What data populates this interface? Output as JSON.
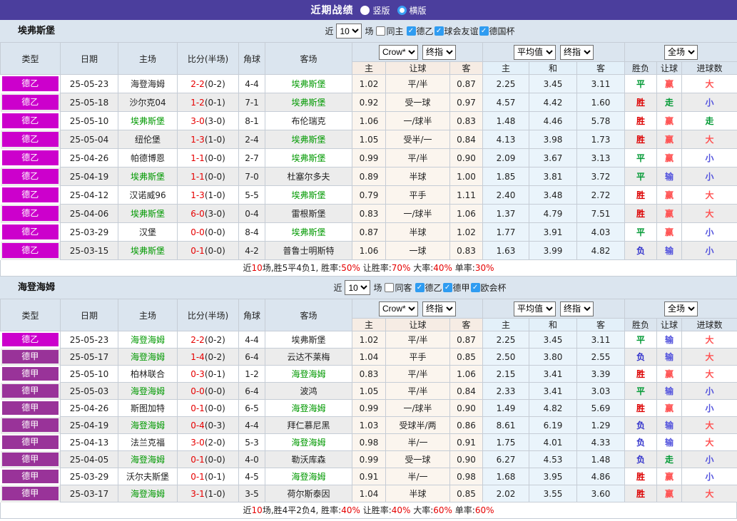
{
  "palette": {
    "titlebar_bg": "#4b3e9d",
    "band_bg": "#dbe5ef",
    "header_bg": "#dbe5ef",
    "row_alt_bg": "#ececec",
    "crow_columns_bg": "#fbf5ee",
    "avg_columns_bg": "#eaf4fb",
    "team_highlight": "#009900",
    "score_red": "#e60000",
    "win_red": "#dd0000",
    "draw_green": "#009933",
    "loss_blue": "#3333cc",
    "cover_red": "#ff5252",
    "fail_blue": "#5252dd",
    "checkbox_blue": "#2f9cf1",
    "type_colors": {
      "de2": "#cc00cc",
      "de1": "#993399"
    }
  },
  "titlebar": {
    "title": "近期战绩",
    "radio_vertical": "竖版",
    "radio_horizontal": "横版"
  },
  "table_header": {
    "cols": [
      "类型",
      "日期",
      "主场",
      "比分(半场)",
      "角球",
      "客场"
    ],
    "group1_selects": [
      "Crow*",
      "终指"
    ],
    "group2_selects": [
      "平均值",
      "终指"
    ],
    "group3_select": "全场",
    "sub1": [
      "主",
      "让球",
      "客"
    ],
    "sub2": [
      "主",
      "和",
      "客"
    ],
    "sub3": [
      "胜负",
      "让球",
      "进球数"
    ]
  },
  "sections": [
    {
      "team": "埃弗斯堡",
      "filter": {
        "prefix": "近",
        "count": "10",
        "suffix": "场",
        "uncheck_label": "同主",
        "checks": [
          "德乙",
          "球会友谊",
          "德国杯"
        ]
      },
      "rows": [
        {
          "lg": "de2",
          "type": "德乙",
          "date": "25-05-23",
          "home": "海登海姆",
          "hh": false,
          "ft": "2-2",
          "ht": "(0-2)",
          "corner": "4-4",
          "away": "埃弗斯堡",
          "ah": true,
          "h": "1.02",
          "hc": "平/半",
          "a": "0.87",
          "m1": "2.25",
          "m2": "3.45",
          "m3": "3.11",
          "res": [
            "平",
            "g"
          ],
          "asia": [
            "赢",
            "rl"
          ],
          "ou": [
            "大",
            "rl"
          ]
        },
        {
          "lg": "de2",
          "type": "德乙",
          "date": "25-05-18",
          "home": "沙尔克04",
          "hh": false,
          "ft": "1-2",
          "ht": "(0-1)",
          "corner": "7-1",
          "away": "埃弗斯堡",
          "ah": true,
          "h": "0.92",
          "hc": "受一球",
          "a": "0.97",
          "m1": "4.57",
          "m2": "4.42",
          "m3": "1.60",
          "res": [
            "胜",
            "r"
          ],
          "asia": [
            "走",
            "g"
          ],
          "ou": [
            "小",
            "bl"
          ]
        },
        {
          "lg": "de2",
          "type": "德乙",
          "date": "25-05-10",
          "home": "埃弗斯堡",
          "hh": true,
          "ft": "3-0",
          "ht": "(3-0)",
          "corner": "8-1",
          "away": "布伦瑞克",
          "ah": false,
          "h": "1.06",
          "hc": "一/球半",
          "a": "0.83",
          "m1": "1.48",
          "m2": "4.46",
          "m3": "5.78",
          "res": [
            "胜",
            "r"
          ],
          "asia": [
            "赢",
            "rl"
          ],
          "ou": [
            "走",
            "g"
          ]
        },
        {
          "lg": "de2",
          "type": "德乙",
          "date": "25-05-04",
          "home": "纽伦堡",
          "hh": false,
          "ft": "1-3",
          "ht": "(1-0)",
          "corner": "2-4",
          "away": "埃弗斯堡",
          "ah": true,
          "h": "1.05",
          "hc": "受半/一",
          "a": "0.84",
          "m1": "4.13",
          "m2": "3.98",
          "m3": "1.73",
          "res": [
            "胜",
            "r"
          ],
          "asia": [
            "赢",
            "rl"
          ],
          "ou": [
            "大",
            "rl"
          ]
        },
        {
          "lg": "de2",
          "type": "德乙",
          "date": "25-04-26",
          "home": "帕德博恩",
          "hh": false,
          "ft": "1-1",
          "ht": "(0-0)",
          "corner": "2-7",
          "away": "埃弗斯堡",
          "ah": true,
          "h": "0.99",
          "hc": "平/半",
          "a": "0.90",
          "m1": "2.09",
          "m2": "3.67",
          "m3": "3.13",
          "res": [
            "平",
            "g"
          ],
          "asia": [
            "赢",
            "rl"
          ],
          "ou": [
            "小",
            "bl"
          ]
        },
        {
          "lg": "de2",
          "type": "德乙",
          "date": "25-04-19",
          "home": "埃弗斯堡",
          "hh": true,
          "ft": "1-1",
          "ht": "(0-0)",
          "corner": "7-0",
          "away": "杜塞尔多夫",
          "ah": false,
          "h": "0.89",
          "hc": "半球",
          "a": "1.00",
          "m1": "1.85",
          "m2": "3.81",
          "m3": "3.72",
          "res": [
            "平",
            "g"
          ],
          "asia": [
            "输",
            "bl"
          ],
          "ou": [
            "小",
            "bl"
          ]
        },
        {
          "lg": "de2",
          "type": "德乙",
          "date": "25-04-12",
          "home": "汉诺威96",
          "hh": false,
          "ft": "1-3",
          "ht": "(1-0)",
          "corner": "5-5",
          "away": "埃弗斯堡",
          "ah": true,
          "h": "0.79",
          "hc": "平手",
          "a": "1.11",
          "m1": "2.40",
          "m2": "3.48",
          "m3": "2.72",
          "res": [
            "胜",
            "r"
          ],
          "asia": [
            "赢",
            "rl"
          ],
          "ou": [
            "大",
            "rl"
          ]
        },
        {
          "lg": "de2",
          "type": "德乙",
          "date": "25-04-06",
          "home": "埃弗斯堡",
          "hh": true,
          "ft": "6-0",
          "ht": "(3-0)",
          "corner": "0-4",
          "away": "雷根斯堡",
          "ah": false,
          "h": "0.83",
          "hc": "一/球半",
          "a": "1.06",
          "m1": "1.37",
          "m2": "4.79",
          "m3": "7.51",
          "res": [
            "胜",
            "r"
          ],
          "asia": [
            "赢",
            "rl"
          ],
          "ou": [
            "大",
            "rl"
          ]
        },
        {
          "lg": "de2",
          "type": "德乙",
          "date": "25-03-29",
          "home": "汉堡",
          "hh": false,
          "ft": "0-0",
          "ht": "(0-0)",
          "corner": "8-4",
          "away": "埃弗斯堡",
          "ah": true,
          "h": "0.87",
          "hc": "半球",
          "a": "1.02",
          "m1": "1.77",
          "m2": "3.91",
          "m3": "4.03",
          "res": [
            "平",
            "g"
          ],
          "asia": [
            "赢",
            "rl"
          ],
          "ou": [
            "小",
            "bl"
          ]
        },
        {
          "lg": "de2",
          "type": "德乙",
          "date": "25-03-15",
          "home": "埃弗斯堡",
          "hh": true,
          "ft": "0-1",
          "ht": "(0-0)",
          "corner": "4-2",
          "away": "普鲁士明斯特",
          "ah": false,
          "h": "1.06",
          "hc": "一球",
          "a": "0.83",
          "m1": "1.63",
          "m2": "3.99",
          "m3": "4.82",
          "res": [
            "负",
            "b"
          ],
          "asia": [
            "输",
            "bl"
          ],
          "ou": [
            "小",
            "bl"
          ]
        }
      ],
      "summary": [
        {
          "t": "近"
        },
        {
          "t": "10",
          "r": true
        },
        {
          "t": "场,胜5平4负1, 胜率:"
        },
        {
          "t": "50%",
          "r": true
        },
        {
          "t": " 让胜率:"
        },
        {
          "t": "70%",
          "r": true
        },
        {
          "t": " 大率:"
        },
        {
          "t": "40%",
          "r": true
        },
        {
          "t": " 单率:"
        },
        {
          "t": "30%",
          "r": true
        }
      ]
    },
    {
      "team": "海登海姆",
      "filter": {
        "prefix": "近",
        "count": "10",
        "suffix": "场",
        "uncheck_label": "同客",
        "checks": [
          "德乙",
          "德甲",
          "欧会杯"
        ]
      },
      "rows": [
        {
          "lg": "de2",
          "type": "德乙",
          "date": "25-05-23",
          "home": "海登海姆",
          "hh": true,
          "ft": "2-2",
          "ht": "(0-2)",
          "corner": "4-4",
          "away": "埃弗斯堡",
          "ah": false,
          "h": "1.02",
          "hc": "平/半",
          "a": "0.87",
          "m1": "2.25",
          "m2": "3.45",
          "m3": "3.11",
          "res": [
            "平",
            "g"
          ],
          "asia": [
            "输",
            "bl"
          ],
          "ou": [
            "大",
            "rl"
          ]
        },
        {
          "lg": "de1",
          "type": "德甲",
          "date": "25-05-17",
          "home": "海登海姆",
          "hh": true,
          "ft": "1-4",
          "ht": "(0-2)",
          "corner": "6-4",
          "away": "云达不莱梅",
          "ah": false,
          "h": "1.04",
          "hc": "平手",
          "a": "0.85",
          "m1": "2.50",
          "m2": "3.80",
          "m3": "2.55",
          "res": [
            "负",
            "b"
          ],
          "asia": [
            "输",
            "bl"
          ],
          "ou": [
            "大",
            "rl"
          ]
        },
        {
          "lg": "de1",
          "type": "德甲",
          "date": "25-05-10",
          "home": "柏林联合",
          "hh": false,
          "ft": "0-3",
          "ht": "(0-1)",
          "corner": "1-2",
          "away": "海登海姆",
          "ah": true,
          "h": "0.83",
          "hc": "平/半",
          "a": "1.06",
          "m1": "2.15",
          "m2": "3.41",
          "m3": "3.39",
          "res": [
            "胜",
            "r"
          ],
          "asia": [
            "赢",
            "rl"
          ],
          "ou": [
            "大",
            "rl"
          ]
        },
        {
          "lg": "de1",
          "type": "德甲",
          "date": "25-05-03",
          "home": "海登海姆",
          "hh": true,
          "ft": "0-0",
          "ht": "(0-0)",
          "corner": "6-4",
          "away": "波鸿",
          "ah": false,
          "h": "1.05",
          "hc": "平/半",
          "a": "0.84",
          "m1": "2.33",
          "m2": "3.41",
          "m3": "3.03",
          "res": [
            "平",
            "g"
          ],
          "asia": [
            "输",
            "bl"
          ],
          "ou": [
            "小",
            "bl"
          ]
        },
        {
          "lg": "de1",
          "type": "德甲",
          "date": "25-04-26",
          "home": "斯图加特",
          "hh": false,
          "ft": "0-1",
          "ht": "(0-0)",
          "corner": "6-5",
          "away": "海登海姆",
          "ah": true,
          "h": "0.99",
          "hc": "一/球半",
          "a": "0.90",
          "m1": "1.49",
          "m2": "4.82",
          "m3": "5.69",
          "res": [
            "胜",
            "r"
          ],
          "asia": [
            "赢",
            "rl"
          ],
          "ou": [
            "小",
            "bl"
          ]
        },
        {
          "lg": "de1",
          "type": "德甲",
          "date": "25-04-19",
          "home": "海登海姆",
          "hh": true,
          "ft": "0-4",
          "ht": "(0-3)",
          "corner": "4-4",
          "away": "拜仁慕尼黑",
          "ah": false,
          "h": "1.03",
          "hc": "受球半/两",
          "a": "0.86",
          "m1": "8.61",
          "m2": "6.19",
          "m3": "1.29",
          "res": [
            "负",
            "b"
          ],
          "asia": [
            "输",
            "bl"
          ],
          "ou": [
            "大",
            "rl"
          ]
        },
        {
          "lg": "de1",
          "type": "德甲",
          "date": "25-04-13",
          "home": "法兰克福",
          "hh": false,
          "ft": "3-0",
          "ht": "(2-0)",
          "corner": "5-3",
          "away": "海登海姆",
          "ah": true,
          "h": "0.98",
          "hc": "半/一",
          "a": "0.91",
          "m1": "1.75",
          "m2": "4.01",
          "m3": "4.33",
          "res": [
            "负",
            "b"
          ],
          "asia": [
            "输",
            "bl"
          ],
          "ou": [
            "大",
            "rl"
          ]
        },
        {
          "lg": "de1",
          "type": "德甲",
          "date": "25-04-05",
          "home": "海登海姆",
          "hh": true,
          "ft": "0-1",
          "ht": "(0-0)",
          "corner": "4-0",
          "away": "勒沃库森",
          "ah": false,
          "h": "0.99",
          "hc": "受一球",
          "a": "0.90",
          "m1": "6.27",
          "m2": "4.53",
          "m3": "1.48",
          "res": [
            "负",
            "b"
          ],
          "asia": [
            "走",
            "g"
          ],
          "ou": [
            "小",
            "bl"
          ]
        },
        {
          "lg": "de1",
          "type": "德甲",
          "date": "25-03-29",
          "home": "沃尔夫斯堡",
          "hh": false,
          "ft": "0-1",
          "ht": "(0-1)",
          "corner": "4-5",
          "away": "海登海姆",
          "ah": true,
          "h": "0.91",
          "hc": "半/一",
          "a": "0.98",
          "m1": "1.68",
          "m2": "3.95",
          "m3": "4.86",
          "res": [
            "胜",
            "r"
          ],
          "asia": [
            "赢",
            "rl"
          ],
          "ou": [
            "小",
            "bl"
          ]
        },
        {
          "lg": "de1",
          "type": "德甲",
          "date": "25-03-17",
          "home": "海登海姆",
          "hh": true,
          "ft": "3-1",
          "ht": "(1-0)",
          "corner": "3-5",
          "away": "荷尔斯泰因",
          "ah": false,
          "h": "1.04",
          "hc": "半球",
          "a": "0.85",
          "m1": "2.02",
          "m2": "3.55",
          "m3": "3.60",
          "res": [
            "胜",
            "r"
          ],
          "asia": [
            "赢",
            "rl"
          ],
          "ou": [
            "大",
            "rl"
          ]
        }
      ],
      "summary": [
        {
          "t": "近"
        },
        {
          "t": "10",
          "r": true
        },
        {
          "t": "场,胜4平2负4, 胜率:"
        },
        {
          "t": "40%",
          "r": true
        },
        {
          "t": " 让胜率:"
        },
        {
          "t": "40%",
          "r": true
        },
        {
          "t": " 大率:"
        },
        {
          "t": "60%",
          "r": true
        },
        {
          "t": " 单率:"
        },
        {
          "t": "60%",
          "r": true
        }
      ]
    }
  ]
}
